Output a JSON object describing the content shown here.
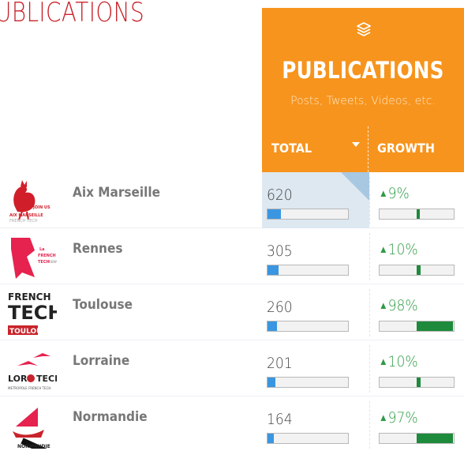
{
  "header": {
    "page_title": "UBLICATIONS",
    "panel_title": "PUBLICATIONS",
    "panel_subtitle": "Posts, Tweets, Videos, etc.",
    "col_total": "TOTAL",
    "col_growth": "GROWTH",
    "icon": "layers-icon"
  },
  "colors": {
    "accent": "#f7941d",
    "title": "#c8242b",
    "bar": "#3a96e0",
    "growth": "#2e9b45",
    "growth_bar": "#1e8a3c",
    "selected": "#dde8f1"
  },
  "rows": [
    {
      "city": "Aix Marseille",
      "total": "620",
      "total_fraction": 0.17,
      "growth": "9%",
      "growth_fraction": 0.09,
      "selected": true
    },
    {
      "city": "Rennes",
      "total": "305",
      "total_fraction": 0.14,
      "growth": "10%",
      "growth_fraction": 0.1,
      "selected": false
    },
    {
      "city": "Toulouse",
      "total": "260",
      "total_fraction": 0.12,
      "growth": "98%",
      "growth_fraction": 0.98,
      "selected": false
    },
    {
      "city": "Lorraine",
      "total": "201",
      "total_fraction": 0.1,
      "growth": "10%",
      "growth_fraction": 0.1,
      "selected": false
    },
    {
      "city": "Normandie",
      "total": "164",
      "total_fraction": 0.08,
      "growth": "97%",
      "growth_fraction": 0.97,
      "selected": false
    }
  ],
  "logos": [
    {
      "kind": "rooster",
      "texts": [
        "JOIN US",
        "AIX MARSEILLE",
        "FRENCH TECH"
      ]
    },
    {
      "kind": "r-mark",
      "texts": [
        "La",
        "FRENCH",
        "TECH",
        "RENNES"
      ]
    },
    {
      "kind": "wordmark",
      "texts": [
        "FRENCH",
        "TECH",
        "TOULOUSE"
      ]
    },
    {
      "kind": "birds",
      "texts": [
        "LOR",
        "TECH",
        "METROPOLE FRENCH TECH"
      ]
    },
    {
      "kind": "ship",
      "texts": [
        "NORMANDIE"
      ]
    }
  ]
}
